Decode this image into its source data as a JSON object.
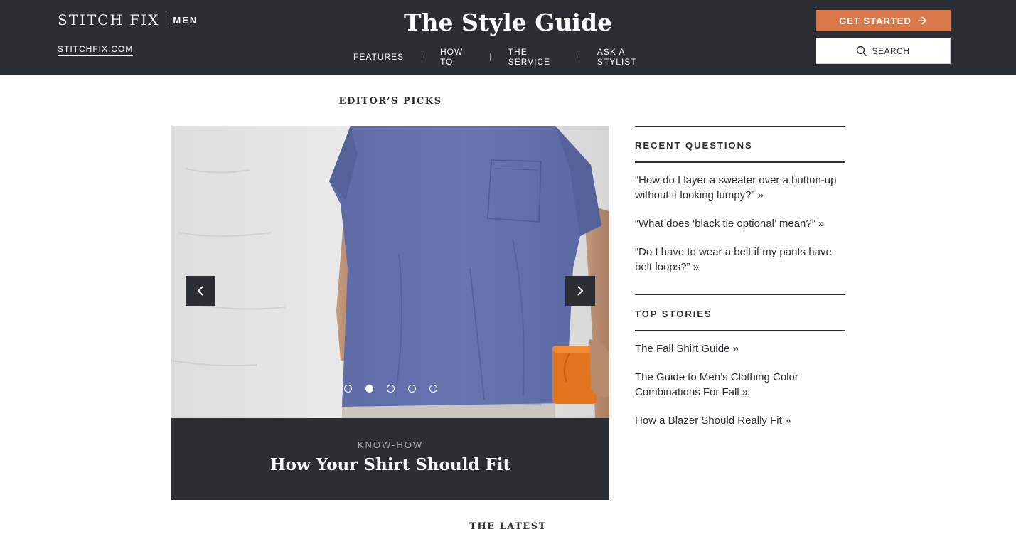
{
  "header": {
    "brand_name": "STITCH FIX",
    "brand_sub": "MEN",
    "site_link": "STITCHFIX.COM",
    "title": "The Style Guide",
    "nav": [
      "FEATURES",
      "HOW TO",
      "THE SERVICE",
      "ASK A STYLIST"
    ],
    "cta_label": "GET STARTED",
    "search_label": "SEARCH"
  },
  "colors": {
    "header_bg": "#2b2e33",
    "cta_bg": "#d9794b",
    "text": "#2b2e33"
  },
  "editors_picks": {
    "heading": "EDITOR’S PICKS",
    "slide_count": 5,
    "active_slide": 2,
    "category": "KNOW-HOW",
    "title": "How Your Shirt Should Fit"
  },
  "sidebar": {
    "recent_questions": {
      "title": "RECENT QUESTIONS",
      "items": [
        "“How do I layer a sweater over a button-up without it looking lumpy?” »",
        "“What does ‘black tie optional’ mean?” »",
        "“Do I have to wear a belt if my pants have belt loops?” »"
      ]
    },
    "top_stories": {
      "title": "TOP STORIES",
      "items": [
        "The Fall Shirt Guide  »",
        "The Guide to Men’s Clothing Color Combinations For Fall  »",
        "How a Blazer Should Really Fit  »"
      ]
    }
  },
  "latest": {
    "heading": "THE LATEST"
  }
}
